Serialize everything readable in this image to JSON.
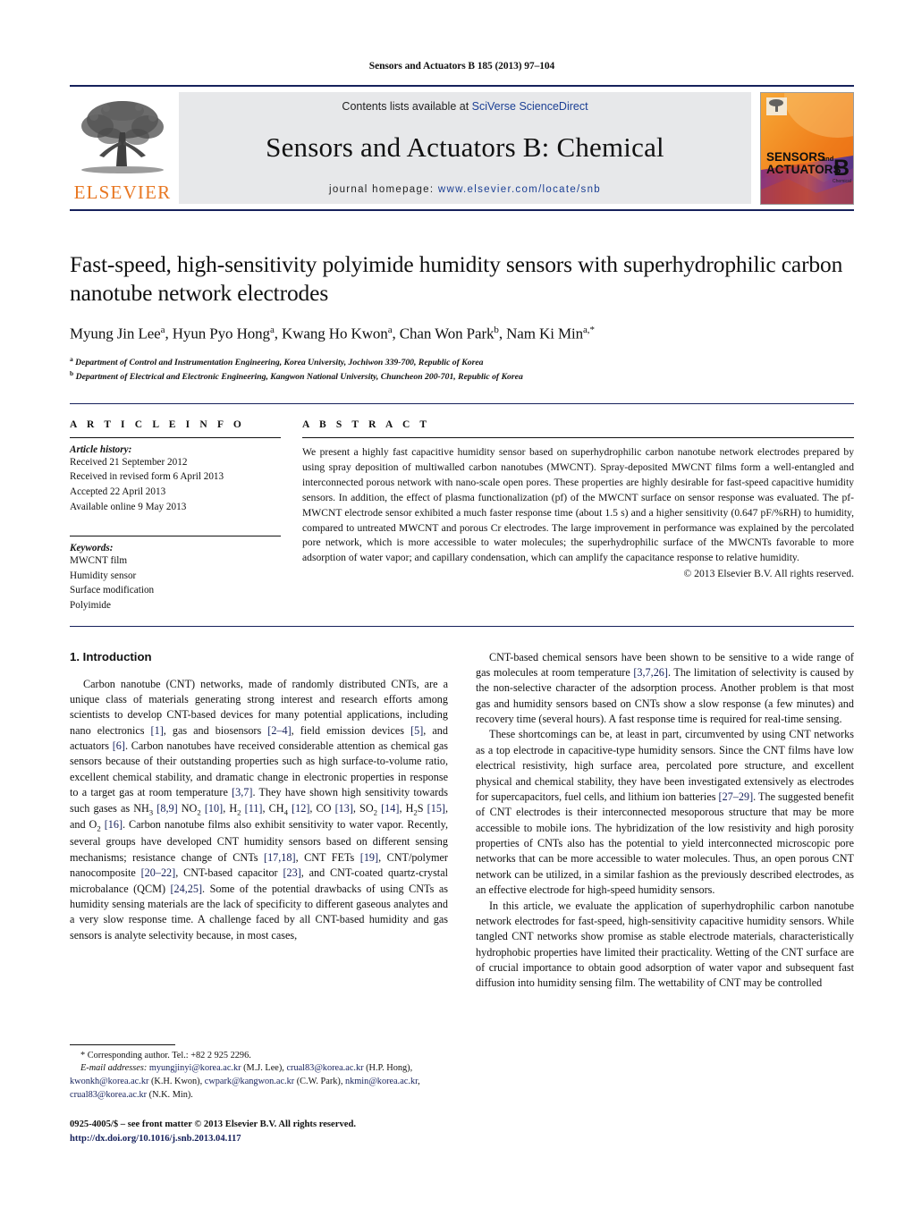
{
  "running_head": "Sensors and Actuators B 185 (2013) 97–104",
  "masthead": {
    "publisher_logo_name": "elsevier-tree-logo",
    "publisher_wordmark": "ELSEVIER",
    "contents_prefix": "Contents lists available at ",
    "contents_link": "SciVerse ScienceDirect",
    "journal_name": "Sensors and Actuators B: Chemical",
    "homepage_prefix": "journal homepage: ",
    "homepage_url": "www.elsevier.com/locate/snb",
    "cover": {
      "line1": "SENSORS",
      "line1_small": "and",
      "line2": "ACTUATORS",
      "letter": "B",
      "letter_sub": "Chemical"
    },
    "accent_orange": "#E87722",
    "rule_navy": "#16215b",
    "band_gray": "#e7e8ea"
  },
  "title": "Fast-speed, high-sensitivity polyimide humidity sensors with superhydrophilic carbon nanotube network electrodes",
  "authors_html": "Myung Jin Lee<sup>a</sup>, Hyun Pyo Hong<sup>a</sup>, Kwang Ho Kwon<sup>a</sup>, Chan Won Park<sup>b</sup>, Nam Ki Min<sup>a,<span class=\"star\">*</span></sup>",
  "affiliations": [
    "Department of Control and Instrumentation Engineering, Korea University, Jochiwon 339-700, Republic of Korea",
    "Department of Electrical and Electronic Engineering, Kangwon National University, Chuncheon 200-701, Republic of Korea"
  ],
  "article_info": {
    "heading": "A R T I C L E   I N F O",
    "history_label": "Article history:",
    "history": [
      "Received 21 September 2012",
      "Received in revised form 6 April 2013",
      "Accepted 22 April 2013",
      "Available online 9 May 2013"
    ],
    "keywords_label": "Keywords:",
    "keywords": [
      "MWCNT film",
      "Humidity sensor",
      "Surface modification",
      "Polyimide"
    ]
  },
  "abstract": {
    "heading": "A B S T R A C T",
    "text": "We present a highly fast capacitive humidity sensor based on superhydrophilic carbon nanotube network electrodes prepared by using spray deposition of multiwalled carbon nanotubes (MWCNT). Spray-deposited MWCNT films form a well-entangled and interconnected porous network with nano-scale open pores. These properties are highly desirable for fast-speed capacitive humidity sensors. In addition, the effect of plasma functionalization (pf) of the MWCNT surface on sensor response was evaluated. The pf-MWCNT electrode sensor exhibited a much faster response time (about 1.5 s) and a higher sensitivity (0.647 pF/%RH) to humidity, compared to untreated MWCNT and porous Cr electrodes. The large improvement in performance was explained by the percolated pore network, which is more accessible to water molecules; the superhydrophilic surface of the MWCNTs favorable to more adsorption of water vapor; and capillary condensation, which can amplify the capacitance response to relative humidity.",
    "copyright": "© 2013 Elsevier B.V. All rights reserved."
  },
  "section_heading": "1.  Introduction",
  "left_column": {
    "para1_html": "Carbon nanotube (CNT) networks, made of randomly distributed CNTs, are a unique class of materials generating strong interest and research efforts among scientists to develop CNT-based devices for many potential applications, including nano electronics <span class=\"ref\">[1]</span>, gas and biosensors <span class=\"ref\">[2–4]</span>, field emission devices <span class=\"ref\">[5]</span>, and actuators <span class=\"ref\">[6]</span>. Carbon nanotubes have received considerable attention as chemical gas sensors because of their outstanding properties such as high surface-to-volume ratio, excellent chemical stability, and dramatic change in electronic properties in response to a target gas at room temperature <span class=\"ref\">[3,7]</span>. They have shown high sensitivity towards such gases as NH<sub>3</sub> <span class=\"ref\">[8,9]</span> NO<sub>2</sub> <span class=\"ref\">[10]</span>, H<sub>2</sub> <span class=\"ref\">[11]</span>, CH<sub>4</sub> <span class=\"ref\">[12]</span>, CO <span class=\"ref\">[13]</span>, SO<sub>2</sub> <span class=\"ref\">[14]</span>, H<sub>2</sub>S <span class=\"ref\">[15]</span>, and O<sub>2</sub> <span class=\"ref\">[16]</span>. Carbon nanotube films also exhibit sensitivity to water vapor. Recently, several groups have developed CNT humidity sensors based on different sensing mechanisms; resistance change of CNTs <span class=\"ref\">[17,18]</span>, CNT FETs <span class=\"ref\">[19]</span>, CNT/polymer nanocomposite <span class=\"ref\">[20–22]</span>, CNT-based capacitor <span class=\"ref\">[23]</span>, and CNT-coated quartz-crystal microbalance (QCM) <span class=\"ref\">[24,25]</span>. Some of the potential drawbacks of using CNTs as humidity sensing materials are the lack of specificity to different gaseous analytes and a very slow response time. A challenge faced by all CNT-based humidity and gas sensors is analyte selectivity because, in most cases,"
  },
  "right_column": {
    "para1_html": "CNT-based chemical sensors have been shown to be sensitive to a wide range of gas molecules at room temperature <span class=\"ref\">[3,7,26]</span>. The limitation of selectivity is caused by the non-selective character of the adsorption process. Another problem is that most gas and humidity sensors based on CNTs show a slow response (a few minutes) and recovery time (several hours). A fast response time is required for real-time sensing.",
    "para2_html": "These shortcomings can be, at least in part, circumvented by using CNT networks as a top electrode in capacitive-type humidity sensors. Since the CNT films have low electrical resistivity, high surface area, percolated pore structure, and excellent physical and chemical stability, they have been investigated extensively as electrodes for supercapacitors, fuel cells, and lithium ion batteries <span class=\"ref\">[27–29]</span>. The suggested benefit of CNT electrodes is their interconnected mesoporous structure that may be more accessible to mobile ions. The hybridization of the low resistivity and high porosity properties of CNTs also has the potential to yield interconnected microscopic pore networks that can be more accessible to water molecules. Thus, an open porous CNT network can be utilized, in a similar fashion as the previously described electrodes, as an effective electrode for high-speed humidity sensors.",
    "para3_html": "In this article, we evaluate the application of superhydrophilic carbon nanotube network electrodes for fast-speed, high-sensitivity capacitive humidity sensors. While tangled CNT networks show promise as stable electrode materials, characteristically hydrophobic properties have limited their practicality. Wetting of the CNT surface are of crucial importance to obtain good adsorption of water vapor and subsequent fast diffusion into humidity sensing film. The wettability of CNT may be controlled"
  },
  "footnotes": {
    "corresponding_html": "* Corresponding author. Tel.: +82 2 925 2296.",
    "emails_html": "<span class=\"em\">E-mail addresses:</span> <span class=\"lnk\">myungjinyi@korea.ac.kr</span> (M.J. Lee), <span class=\"lnk\">crual83@korea.ac.kr</span> (H.P. Hong), <span class=\"lnk\">kwonkh@korea.ac.kr</span> (K.H. Kwon), <span class=\"lnk\">cwpark@kangwon.ac.kr</span> (C.W. Park), <span class=\"lnk\">nkmin@korea.ac.kr</span>, <span class=\"lnk\">crual83@korea.ac.kr</span> (N.K. Min).",
    "issn_line": "0925-4005/$ – see front matter © 2013 Elsevier B.V. All rights reserved.",
    "doi_line": "http://dx.doi.org/10.1016/j.snb.2013.04.117"
  }
}
